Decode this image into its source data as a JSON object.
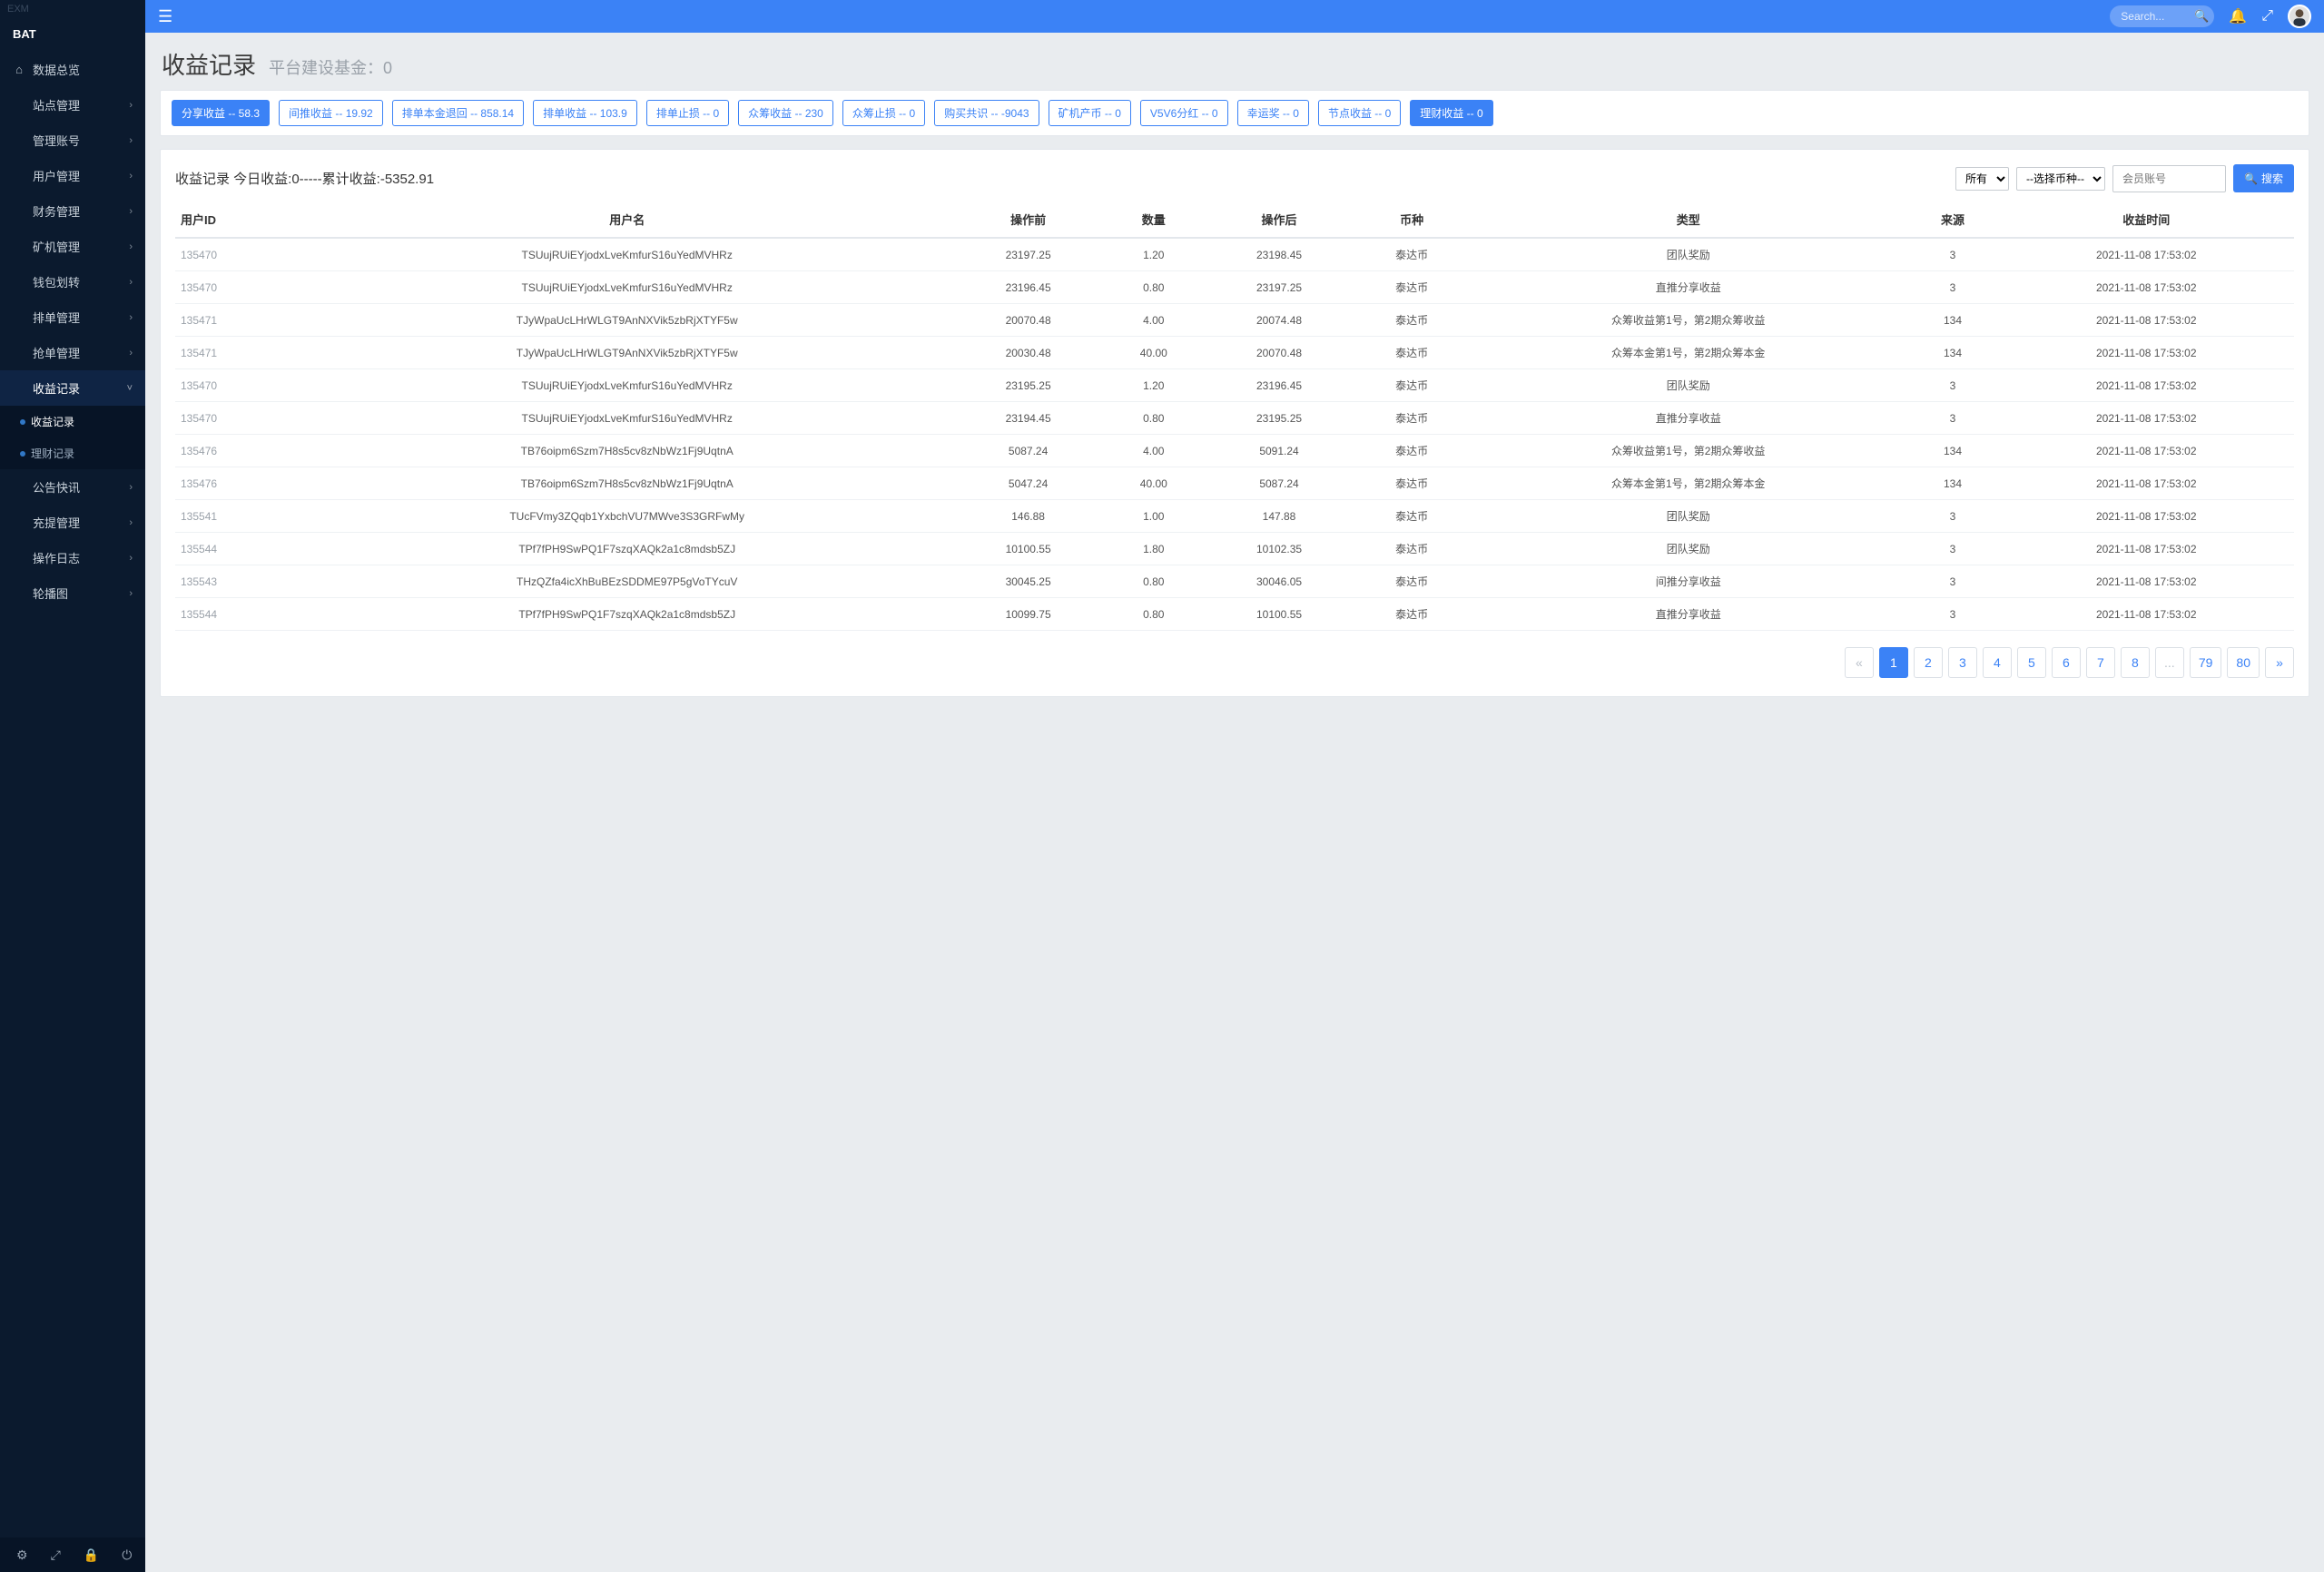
{
  "sidebar": {
    "top_label": "EXM",
    "brand": "BAT",
    "items": [
      {
        "label": "数据总览",
        "icon": "⌂",
        "expandable": false
      },
      {
        "label": "站点管理",
        "icon": "",
        "expandable": true
      },
      {
        "label": "管理账号",
        "icon": "",
        "expandable": true
      },
      {
        "label": "用户管理",
        "icon": "",
        "expandable": true
      },
      {
        "label": "财务管理",
        "icon": "",
        "expandable": true
      },
      {
        "label": "矿机管理",
        "icon": "",
        "expandable": true
      },
      {
        "label": "钱包划转",
        "icon": "",
        "expandable": true
      },
      {
        "label": "排单管理",
        "icon": "",
        "expandable": true
      },
      {
        "label": "抢单管理",
        "icon": "",
        "expandable": true
      },
      {
        "label": "收益记录",
        "icon": "",
        "expandable": true,
        "open": true,
        "children": [
          {
            "label": "收益记录",
            "active": true
          },
          {
            "label": "理财记录",
            "active": false
          }
        ]
      },
      {
        "label": "公告快讯",
        "icon": "",
        "expandable": true
      },
      {
        "label": "充提管理",
        "icon": "",
        "expandable": true
      },
      {
        "label": "操作日志",
        "icon": "",
        "expandable": true
      },
      {
        "label": "轮播图",
        "icon": "",
        "expandable": true
      }
    ],
    "footer_icons": [
      "⚙",
      "⤢",
      "🔒",
      "⏻"
    ]
  },
  "topbar": {
    "search_placeholder": "Search...",
    "icons": {
      "bell": "🔔",
      "expand": "⤢"
    }
  },
  "page": {
    "title": "收益记录",
    "subtitle": "平台建设基金：0"
  },
  "tags": [
    {
      "label": "分享收益 -- 58.3",
      "active": true
    },
    {
      "label": "间推收益 -- 19.92",
      "active": false
    },
    {
      "label": "排单本金退回 -- 858.14",
      "active": false
    },
    {
      "label": "排单收益 -- 103.9",
      "active": false
    },
    {
      "label": "排单止损 -- 0",
      "active": false
    },
    {
      "label": "众筹收益 -- 230",
      "active": false
    },
    {
      "label": "众筹止损 -- 0",
      "active": false
    },
    {
      "label": "购买共识 -- -9043",
      "active": false
    },
    {
      "label": "矿机产币 -- 0",
      "active": false
    },
    {
      "label": "V5V6分红 -- 0",
      "active": false
    },
    {
      "label": "幸运奖 -- 0",
      "active": false
    },
    {
      "label": "节点收益 -- 0",
      "active": false
    },
    {
      "label": "理财收益 -- 0",
      "active": true
    }
  ],
  "table": {
    "header_text": "收益记录 今日收益:0-----累计收益:-5352.91",
    "filter_all_label": "所有",
    "filter_coin_label": "--选择币种--",
    "filter_input_placeholder": "会员账号",
    "search_btn": "搜索",
    "columns": [
      "用户ID",
      "用户名",
      "操作前",
      "数量",
      "操作后",
      "币种",
      "类型",
      "来源",
      "收益时间"
    ],
    "rows": [
      {
        "c0": "135470",
        "c1": "TSUujRUiEYjodxLveKmfurS16uYedMVHRz",
        "c2": "23197.25",
        "c3": "1.20",
        "c4": "23198.45",
        "c5": "泰达币",
        "c6": "团队奖励",
        "c7": "3",
        "c8": "2021-11-08 17:53:02"
      },
      {
        "c0": "135470",
        "c1": "TSUujRUiEYjodxLveKmfurS16uYedMVHRz",
        "c2": "23196.45",
        "c3": "0.80",
        "c4": "23197.25",
        "c5": "泰达币",
        "c6": "直推分享收益",
        "c7": "3",
        "c8": "2021-11-08 17:53:02"
      },
      {
        "c0": "135471",
        "c1": "TJyWpaUcLHrWLGT9AnNXVik5zbRjXTYF5w",
        "c2": "20070.48",
        "c3": "4.00",
        "c4": "20074.48",
        "c5": "泰达币",
        "c6": "众筹收益第1号，第2期众筹收益",
        "c7": "134",
        "c8": "2021-11-08 17:53:02"
      },
      {
        "c0": "135471",
        "c1": "TJyWpaUcLHrWLGT9AnNXVik5zbRjXTYF5w",
        "c2": "20030.48",
        "c3": "40.00",
        "c4": "20070.48",
        "c5": "泰达币",
        "c6": "众筹本金第1号，第2期众筹本金",
        "c7": "134",
        "c8": "2021-11-08 17:53:02"
      },
      {
        "c0": "135470",
        "c1": "TSUujRUiEYjodxLveKmfurS16uYedMVHRz",
        "c2": "23195.25",
        "c3": "1.20",
        "c4": "23196.45",
        "c5": "泰达币",
        "c6": "团队奖励",
        "c7": "3",
        "c8": "2021-11-08 17:53:02"
      },
      {
        "c0": "135470",
        "c1": "TSUujRUiEYjodxLveKmfurS16uYedMVHRz",
        "c2": "23194.45",
        "c3": "0.80",
        "c4": "23195.25",
        "c5": "泰达币",
        "c6": "直推分享收益",
        "c7": "3",
        "c8": "2021-11-08 17:53:02"
      },
      {
        "c0": "135476",
        "c1": "TB76oipm6Szm7H8s5cv8zNbWz1Fj9UqtnA",
        "c2": "5087.24",
        "c3": "4.00",
        "c4": "5091.24",
        "c5": "泰达币",
        "c6": "众筹收益第1号，第2期众筹收益",
        "c7": "134",
        "c8": "2021-11-08 17:53:02"
      },
      {
        "c0": "135476",
        "c1": "TB76oipm6Szm7H8s5cv8zNbWz1Fj9UqtnA",
        "c2": "5047.24",
        "c3": "40.00",
        "c4": "5087.24",
        "c5": "泰达币",
        "c6": "众筹本金第1号，第2期众筹本金",
        "c7": "134",
        "c8": "2021-11-08 17:53:02"
      },
      {
        "c0": "135541",
        "c1": "TUcFVmy3ZQqb1YxbchVU7MWve3S3GRFwMy",
        "c2": "146.88",
        "c3": "1.00",
        "c4": "147.88",
        "c5": "泰达币",
        "c6": "团队奖励",
        "c7": "3",
        "c8": "2021-11-08 17:53:02"
      },
      {
        "c0": "135544",
        "c1": "TPf7fPH9SwPQ1F7szqXAQk2a1c8mdsb5ZJ",
        "c2": "10100.55",
        "c3": "1.80",
        "c4": "10102.35",
        "c5": "泰达币",
        "c6": "团队奖励",
        "c7": "3",
        "c8": "2021-11-08 17:53:02"
      },
      {
        "c0": "135543",
        "c1": "THzQZfa4icXhBuBEzSDDME97P5gVoTYcuV",
        "c2": "30045.25",
        "c3": "0.80",
        "c4": "30046.05",
        "c5": "泰达币",
        "c6": "间推分享收益",
        "c7": "3",
        "c8": "2021-11-08 17:53:02"
      },
      {
        "c0": "135544",
        "c1": "TPf7fPH9SwPQ1F7szqXAQk2a1c8mdsb5ZJ",
        "c2": "10099.75",
        "c3": "0.80",
        "c4": "10100.55",
        "c5": "泰达币",
        "c6": "直推分享收益",
        "c7": "3",
        "c8": "2021-11-08 17:53:02"
      }
    ]
  },
  "pagination": {
    "prev": "«",
    "pages": [
      "1",
      "2",
      "3",
      "4",
      "5",
      "6",
      "7",
      "8",
      "...",
      "79",
      "80"
    ],
    "active": "1",
    "next": "»"
  }
}
